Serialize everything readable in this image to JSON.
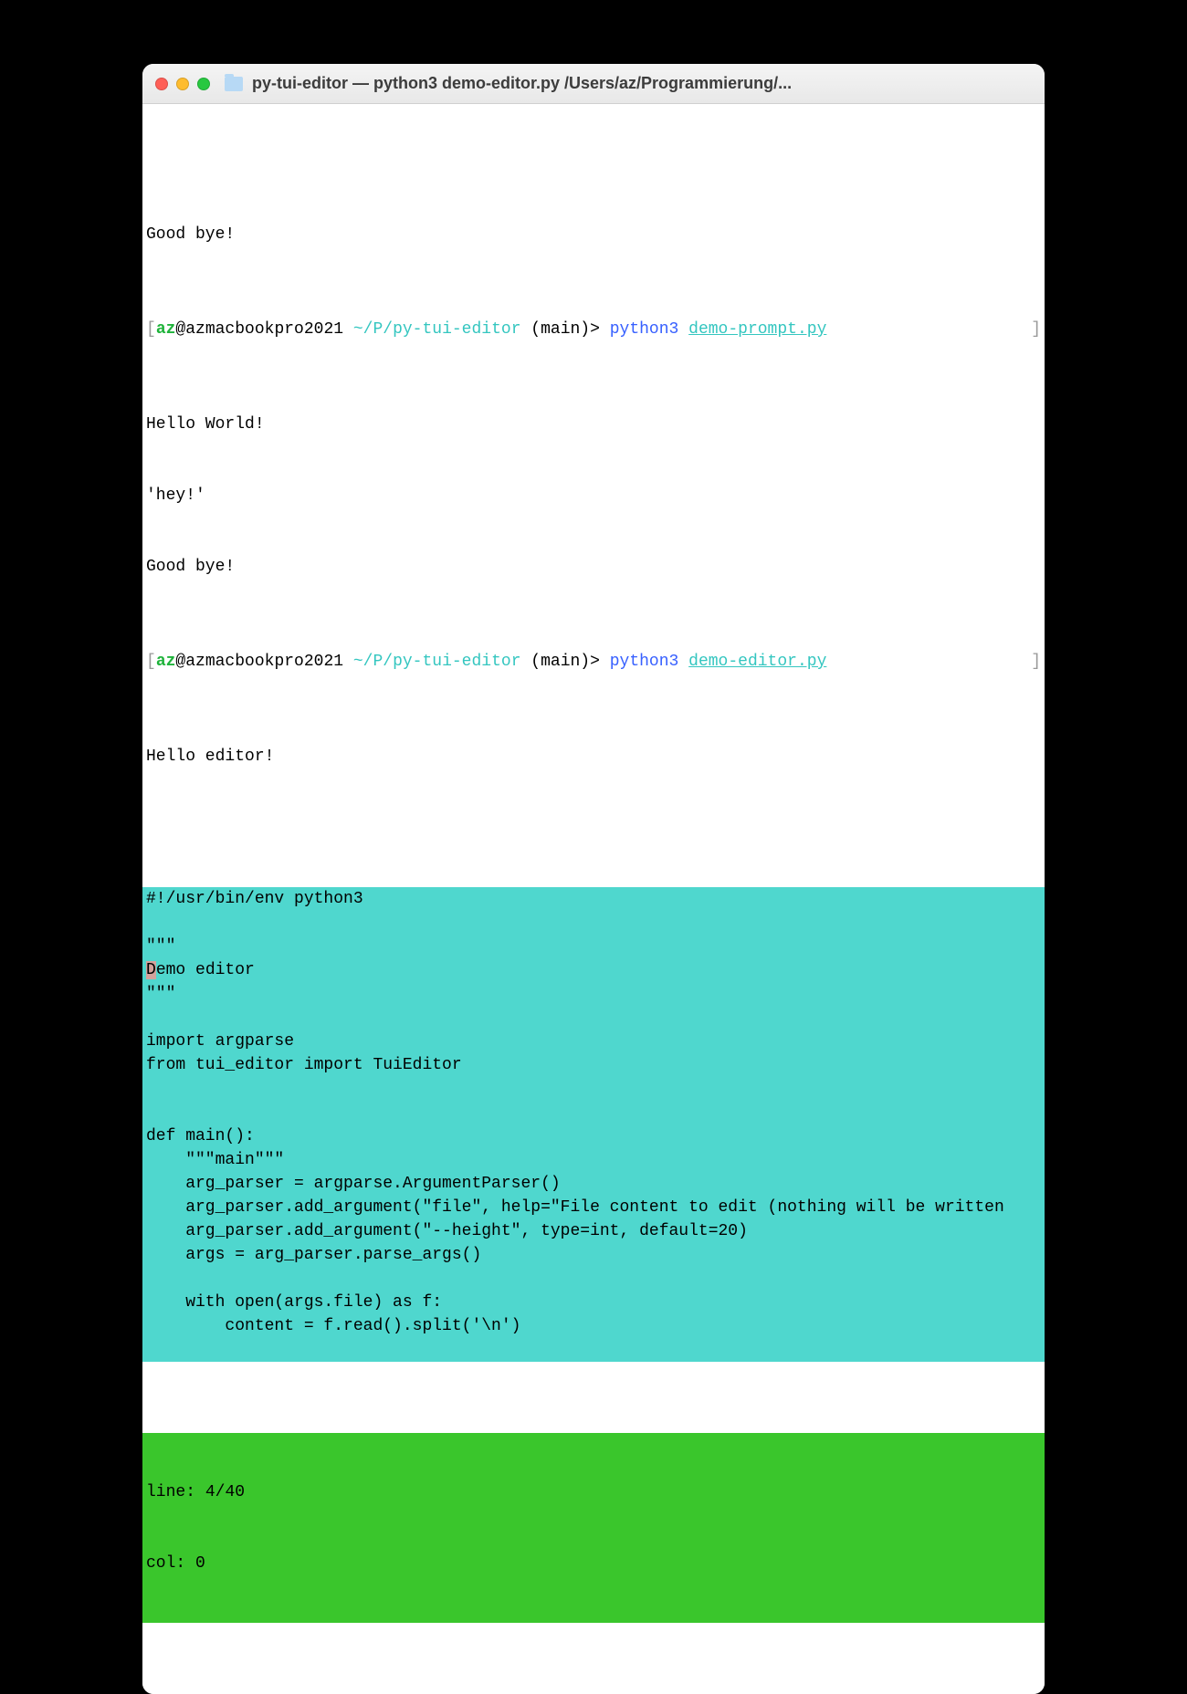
{
  "window": {
    "title": "py-tui-editor — python3 demo-editor.py /Users/az/Programmierung/..."
  },
  "scrollback": {
    "goodbye1": "Good bye!",
    "prompt1": {
      "open": "[",
      "user": "az",
      "at": "@azmacbookpro2021 ",
      "path": "~/P/py-tui-editor",
      "branch": " (main)> ",
      "cmd": "python3 ",
      "file": "demo-prompt.py",
      "close": "]"
    },
    "out1": "Hello World!",
    "out2": "'hey!'",
    "goodbye2": "Good bye!",
    "prompt2": {
      "open": "[",
      "user": "az",
      "at": "@azmacbookpro2021 ",
      "path": "~/P/py-tui-editor",
      "branch": " (main)> ",
      "cmd": "python3 ",
      "file": "demo-editor.py",
      "close": "]"
    },
    "out3": "Hello editor!"
  },
  "editor": {
    "lines": [
      "#!/usr/bin/env python3",
      "",
      "\"\"\"",
      "Demo editor",
      "\"\"\"",
      "",
      "import argparse",
      "from tui_editor import TuiEditor",
      "",
      "",
      "def main():",
      "    \"\"\"main\"\"\"",
      "    arg_parser = argparse.ArgumentParser()",
      "    arg_parser.add_argument(\"file\", help=\"File content to edit (nothing will be written ",
      "    arg_parser.add_argument(\"--height\", type=int, default=20)",
      "    args = arg_parser.parse_args()",
      "",
      "    with open(args.file) as f:",
      "        content = f.read().split('\\n')",
      ""
    ],
    "cursor": {
      "line": 3,
      "col": 0
    }
  },
  "status": {
    "line_label": "line: ",
    "line_current": 4,
    "line_total": 40,
    "col_label": "col: ",
    "col_value": 0
  }
}
